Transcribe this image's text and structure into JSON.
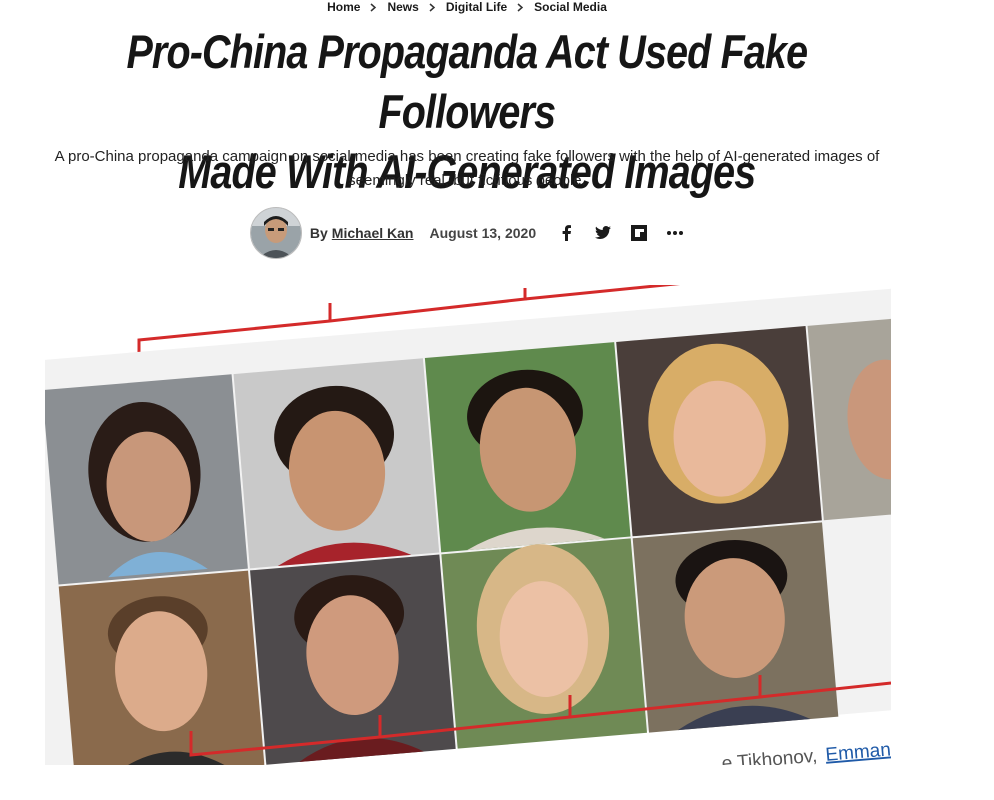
{
  "breadcrumb": {
    "items": [
      "Home",
      "News",
      "Digital Life",
      "Social Media"
    ]
  },
  "article": {
    "title_line1": "Pro-China Propaganda Act Used Fake Followers",
    "title_line2": "Made With AI-Generated Images",
    "deck": "A pro-China propaganda campaign on social media has been creating fake followers with the help of AI-generated images of seemingly real, but fictitious people.",
    "byline_prefix": "By",
    "author": "Michael Kan",
    "date": "August 13, 2020"
  },
  "share": {
    "icons": [
      "facebook-icon",
      "twitter-icon",
      "flipboard-icon",
      "more-icon"
    ]
  },
  "hero_image": {
    "caption_text": "...e Tikhonov,",
    "caption_link": "Emmanue"
  },
  "colors": {
    "text": "#1a1a1a",
    "bracket_red": "#d42a2a",
    "link_blue": "#1f5aa8"
  }
}
